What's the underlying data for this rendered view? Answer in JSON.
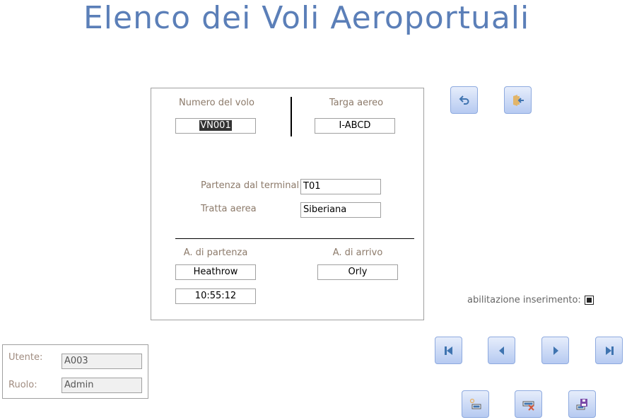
{
  "title": "Elenco dei Voli Aeroportuali",
  "form": {
    "numero_label": "Numero del volo",
    "numero_value": "VN001",
    "targa_label": "Targa aereo",
    "targa_value": "I-ABCD",
    "terminal_label": "Partenza dal terminal",
    "terminal_value": "T01",
    "tratta_label": "Tratta aerea",
    "tratta_value": "Siberiana",
    "partenza_label": "A. di partenza",
    "partenza_value": "Heathrow",
    "arrivo_label": "A. di arrivo",
    "arrivo_value": "Orly",
    "orario_value": "10:55:12"
  },
  "insert_toggle": {
    "label": "abilitazione inserimento:",
    "checked": true
  },
  "user": {
    "utente_label": "Utente:",
    "utente_value": "A003",
    "ruolo_label": "Ruolo:",
    "ruolo_value": "Admin"
  },
  "colors": {
    "title": "#5b7fb8",
    "icon": "#3f74b0",
    "button_border": "#8eaadf"
  }
}
